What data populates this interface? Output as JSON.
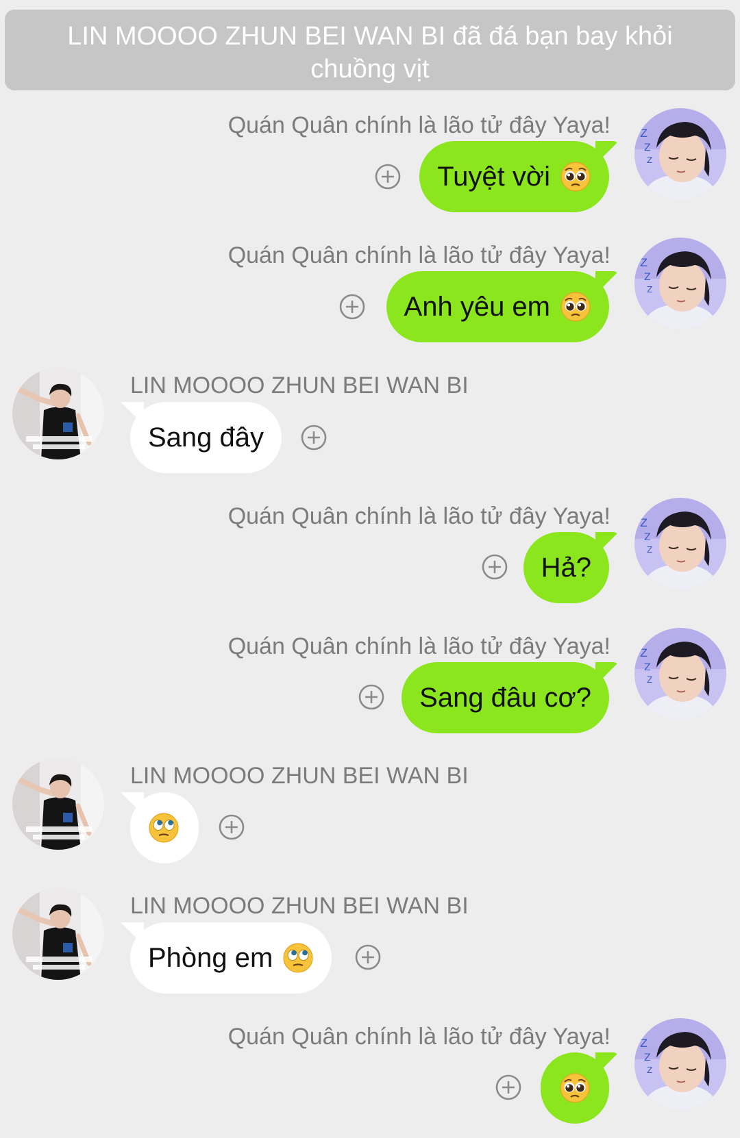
{
  "system_notice": "LIN MOOOO ZHUN BEI WAN BI đã đá bạn bay khỏi chuồng vịt",
  "participants": {
    "me": {
      "name": "Quán Quân chính là lão tử đây Yaya!",
      "avatar_icon": "sleeping-boy-avatar"
    },
    "other": {
      "name": "LIN MOOOO ZHUN BEI WAN BI",
      "avatar_icon": "dancing-boy-avatar"
    }
  },
  "colors": {
    "background": "#ededed",
    "my_bubble": "#8ce61e",
    "their_bubble": "#ffffff",
    "banner": "#c6c6c6",
    "name_text": "#7b7b7b"
  },
  "messages": [
    {
      "sender": "Quán Quân chính là lão tử đây Yaya!",
      "text": "Tuyệt vời",
      "emoji": "pleading-face"
    },
    {
      "sender": "Quán Quân chính là lão tử đây Yaya!",
      "text": "Anh yêu em",
      "emoji": "pleading-face"
    },
    {
      "sender": "LIN MOOOO ZHUN BEI WAN BI",
      "text": "Sang đây",
      "emoji": ""
    },
    {
      "sender": "Quán Quân chính là lão tử đây Yaya!",
      "text": "Hả?",
      "emoji": ""
    },
    {
      "sender": "Quán Quân chính là lão tử đây Yaya!",
      "text": "Sang đâu cơ?",
      "emoji": ""
    },
    {
      "sender": "LIN MOOOO ZHUN BEI WAN BI",
      "text": "",
      "emoji": "rolling-eyes-face"
    },
    {
      "sender": "LIN MOOOO ZHUN BEI WAN BI",
      "text": "Phòng em",
      "emoji": "rolling-eyes-face"
    },
    {
      "sender": "Quán Quân chính là lão tử đây Yaya!",
      "text": "",
      "emoji": "pleading-face"
    }
  ]
}
